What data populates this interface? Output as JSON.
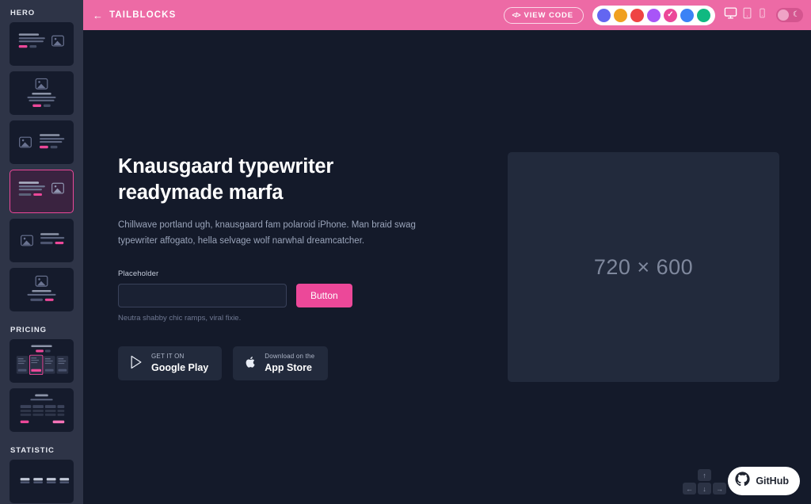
{
  "sidebar": {
    "sections": [
      {
        "label": "HERO",
        "items": [
          {
            "name": "hero-layout-1",
            "selected": false
          },
          {
            "name": "hero-layout-2",
            "selected": false
          },
          {
            "name": "hero-layout-3",
            "selected": false
          },
          {
            "name": "hero-layout-4",
            "selected": true
          },
          {
            "name": "hero-layout-5",
            "selected": false
          },
          {
            "name": "hero-layout-6",
            "selected": false
          }
        ]
      },
      {
        "label": "PRICING",
        "items": [
          {
            "name": "pricing-layout-1",
            "selected": false
          },
          {
            "name": "pricing-layout-2",
            "selected": false
          }
        ]
      },
      {
        "label": "STATISTIC",
        "items": [
          {
            "name": "statistic-layout-1",
            "selected": false
          }
        ]
      }
    ]
  },
  "topbar": {
    "back_icon": "arrow-left-icon",
    "brand": "TAILBLOCKS",
    "view_code_label": "VIEW CODE",
    "view_code_icon": "code-brackets-icon",
    "swatches": [
      {
        "name": "indigo",
        "color": "#6366f1",
        "selected": false
      },
      {
        "name": "amber",
        "color": "#f0a020",
        "selected": false
      },
      {
        "name": "red",
        "color": "#ef4444",
        "selected": false
      },
      {
        "name": "purple",
        "color": "#a855f7",
        "selected": false
      },
      {
        "name": "pink",
        "color": "#ec4899",
        "selected": true
      },
      {
        "name": "blue",
        "color": "#3b82f6",
        "selected": false
      },
      {
        "name": "emerald",
        "color": "#10b981",
        "selected": false
      }
    ],
    "devices": [
      {
        "name": "desktop",
        "active": true
      },
      {
        "name": "tablet",
        "active": false
      },
      {
        "name": "mobile",
        "active": false
      }
    ],
    "dark_mode": {
      "icon": "moon-icon",
      "enabled": true
    }
  },
  "hero": {
    "title": "Knausgaard typewriter readymade marfa",
    "description": "Chillwave portland ugh, knausgaard fam polaroid iPhone. Man braid swag typewriter affogato, hella selvage wolf narwhal dreamcatcher.",
    "field_label": "Placeholder",
    "field_value": "",
    "field_placeholder": "",
    "button_label": "Button",
    "helper_text": "Neutra shabby chic ramps, viral fixie.",
    "stores": [
      {
        "icon": "google-play-icon",
        "small": "GET IT ON",
        "big": "Google Play"
      },
      {
        "icon": "apple-icon",
        "small": "Download on the",
        "big": "App Store"
      }
    ],
    "image_placeholder": "720 × 600"
  },
  "footer": {
    "arrow_keys": {
      "up": "↑",
      "left": "←",
      "down": "↓",
      "right": "→"
    },
    "github_label": "GitHub",
    "github_icon": "github-icon"
  },
  "colors": {
    "accent": "#ec4899",
    "topbar": "#ed6aa5",
    "sidebar_bg": "#2e3447",
    "main_bg": "#141a2a",
    "panel_bg": "#222a3c"
  }
}
